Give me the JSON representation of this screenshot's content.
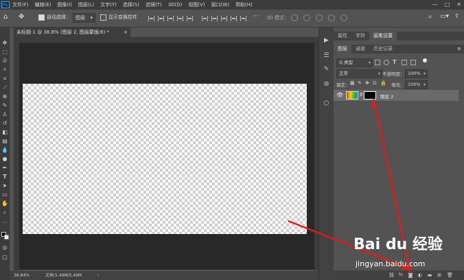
{
  "app": {
    "logo": "Ps"
  },
  "menu": [
    "文件(F)",
    "编辑(E)",
    "图像(I)",
    "图层(L)",
    "文字(Y)",
    "选择(S)",
    "滤镜(T)",
    "3D(D)",
    "视图(V)",
    "窗口(W)",
    "帮助(H)"
  ],
  "window_controls": [
    "—",
    "□",
    "✕"
  ],
  "options_bar": {
    "auto_select_label": "自动选择：",
    "auto_select_value": "图层",
    "show_transform_label": "显示变换控件",
    "mode_3d_label": "3D 模式："
  },
  "document": {
    "tab_title": "未标题-1 @ 38.8% (图层 2, 图层蒙版/8) *",
    "tab_close": "×"
  },
  "status": {
    "zoom": "38.84%",
    "doc_info": "文档:5.49M/5.49M"
  },
  "panels_top": {
    "tabs": [
      "属性",
      "字符",
      "画笔设置"
    ],
    "active": "画笔设置"
  },
  "layers_panel": {
    "tabs": [
      "图层",
      "通道",
      "历史记录"
    ],
    "active": "图层",
    "filter_kind": "Q 类型",
    "blend_mode": "正常",
    "opacity_label": "不透明度：",
    "opacity_value": "100%",
    "lock_label": "锁定：",
    "fill_label": "填充：",
    "fill_value": "100%",
    "layers": [
      {
        "name": "图层 2",
        "visible": true
      }
    ]
  },
  "watermark": {
    "brand": "Bai du 经验",
    "url": "jingyan.baidu.com"
  },
  "colors": {
    "app_bg": "#535353",
    "canvas_bg": "#282828",
    "annotation": "#e21b1b"
  }
}
